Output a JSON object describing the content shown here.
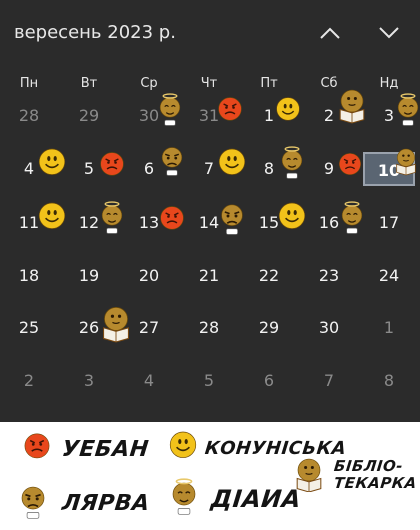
{
  "calendar": {
    "title": "вересень 2023 р.",
    "weekdays": [
      "Пн",
      "Вт",
      "Ср",
      "Чт",
      "Пт",
      "Сб",
      "Нд"
    ],
    "weeks": [
      [
        "28",
        "29",
        "30",
        "31",
        "1",
        "2",
        "3"
      ],
      [
        "4",
        "5",
        "6",
        "7",
        "8",
        "9",
        "10"
      ],
      [
        "11",
        "12",
        "13",
        "14",
        "15",
        "16",
        "17"
      ],
      [
        "18",
        "19",
        "20",
        "21",
        "22",
        "23",
        "24"
      ],
      [
        "25",
        "26",
        "27",
        "28",
        "29",
        "30",
        "1"
      ],
      [
        "2",
        "3",
        "4",
        "5",
        "6",
        "7",
        "8"
      ]
    ],
    "today": "10",
    "prev_icon": "chevron-up-icon",
    "next_icon": "chevron-down-icon"
  },
  "legend": {
    "angry": "УЕБАН",
    "smile": "КОНУНІСЬКА",
    "librarian_line1": "БІБЛІО-",
    "librarian_line2": "ТЕКАРКА",
    "frown": "ЛЯРВА",
    "angel": "ДІАИА"
  },
  "colors": {
    "background": "#2b2b2b",
    "today_fill": "#5a6572",
    "yellow": "#f2c21a",
    "red": "#e8471c",
    "brown": "#b78a2e"
  }
}
